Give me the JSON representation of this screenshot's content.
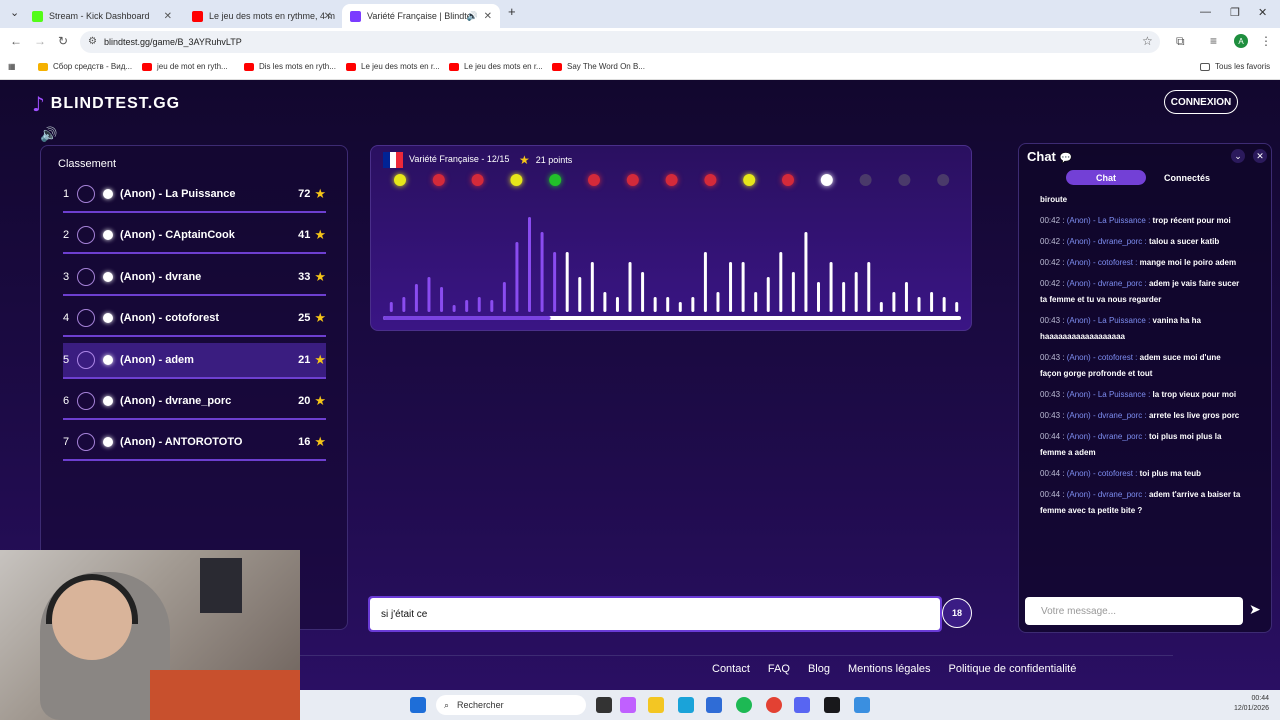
{
  "browser": {
    "tabs": [
      {
        "title": "Stream - Kick Dashboard",
        "color": "#53fc18"
      },
      {
        "title": "Le jeu des mots en rythme, 4 m",
        "color": "#ff0000"
      },
      {
        "title": "Variété Française | Blindtest",
        "color": "#7b3cff"
      }
    ],
    "new_tab": "+",
    "url": "blindtest.gg/game/B_3AYRuhvLTP",
    "bookmarks": [
      "Сбор средств - Вид...",
      "jeu de mot en ryth...",
      "Dis les mots en ryth...",
      "Le jeu des mots en r...",
      "Le jeu des mots en r...",
      "Say The Word On B..."
    ],
    "all_favorites": "Tous les favoris",
    "profile_initial": "A"
  },
  "site": {
    "logo": "BLINDTEST.GG",
    "connexion": "CONNEXION",
    "ranking_title": "Classement",
    "ranking": [
      {
        "rank": "1",
        "name": "(Anon) - La Puissance",
        "points": "72"
      },
      {
        "rank": "2",
        "name": "(Anon) - CAptainCook",
        "points": "41"
      },
      {
        "rank": "3",
        "name": "(Anon) - dvrane",
        "points": "33"
      },
      {
        "rank": "4",
        "name": "(Anon) - cotoforest",
        "points": "25"
      },
      {
        "rank": "5",
        "name": "(Anon) - adem",
        "points": "21"
      },
      {
        "rank": "6",
        "name": "(Anon) - dvrane_porc",
        "points": "20"
      },
      {
        "rank": "7",
        "name": "(Anon) - ANTOROTOTO",
        "points": "16"
      }
    ],
    "player": {
      "title": "Variété Française - 12/15",
      "points": "21 points",
      "progress": 0.29,
      "rounds": [
        "yellow",
        "red",
        "red",
        "yellow",
        "green",
        "red",
        "red",
        "red",
        "red",
        "yellow",
        "red",
        "white",
        "grey",
        "grey",
        "grey"
      ],
      "round_colors": {
        "yellow": "#e6e61a",
        "red": "#d42a3a",
        "green": "#22c02a",
        "white": "#ffffff",
        "grey": "#4a3a6a"
      },
      "bars": [
        0.1,
        0.15,
        0.28,
        0.35,
        0.25,
        0.07,
        0.12,
        0.15,
        0.12,
        0.3,
        0.7,
        0.95,
        0.8,
        0.6,
        0.6,
        0.35,
        0.5,
        0.2,
        0.15,
        0.5,
        0.4,
        0.15,
        0.15,
        0.1,
        0.15,
        0.6,
        0.2,
        0.5,
        0.5,
        0.2,
        0.35,
        0.6,
        0.4,
        0.8,
        0.3,
        0.5,
        0.3,
        0.4,
        0.5,
        0.1,
        0.2,
        0.3,
        0.15,
        0.2,
        0.15,
        0.1
      ]
    },
    "answer_value": "si j'était ce",
    "counter": "18",
    "chat": {
      "title": "Chat",
      "tab_chat": "Chat",
      "tab_connected": "Connectés",
      "placeholder": "Votre message...",
      "messages": [
        {
          "time": "",
          "user": "",
          "text": "biroute"
        },
        {
          "time": "00:42 :",
          "user": "(Anon) - La Puissance :",
          "text": "trop récent pour moi"
        },
        {
          "time": "00:42 :",
          "user": "(Anon) - dvrane_porc :",
          "text": "talou a sucer katib"
        },
        {
          "time": "00:42 :",
          "user": "(Anon) - cotoforest :",
          "text": "mange moi le poiro adem"
        },
        {
          "time": "00:42 :",
          "user": "(Anon) - dvrane_porc :",
          "text": "adem je vais faire sucer ta femme et tu va nous regarder"
        },
        {
          "time": "00:43 :",
          "user": "(Anon) - La Puissance :",
          "text": "vanina ha ha haaaaaaaaaaaaaaaaaa"
        },
        {
          "time": "00:43 :",
          "user": "(Anon) - cotoforest :",
          "text": "adem suce moi d'une façon gorge profronde et tout"
        },
        {
          "time": "00:43 :",
          "user": "(Anon) - La Puissance :",
          "text": "la trop vieux pour moi"
        },
        {
          "time": "00:43 :",
          "user": "(Anon) - dvrane_porc :",
          "text": "arrete les live gros porc"
        },
        {
          "time": "00:44 :",
          "user": "(Anon) - dvrane_porc :",
          "text": "toi plus moi plus la femme a adem"
        },
        {
          "time": "00:44 :",
          "user": "(Anon) - cotoforest :",
          "text": "toi plus ma teub"
        },
        {
          "time": "00:44 :",
          "user": "(Anon) - dvrane_porc :",
          "text": "adem t'arrive a baiser ta femme avec ta petite bite ?"
        }
      ]
    },
    "footer": [
      "Contact",
      "FAQ",
      "Blog",
      "Mentions légales",
      "Politique de confidentialité"
    ]
  },
  "taskbar": {
    "search": "Rechercher",
    "time": "00:44",
    "date": "12/01/2026"
  }
}
